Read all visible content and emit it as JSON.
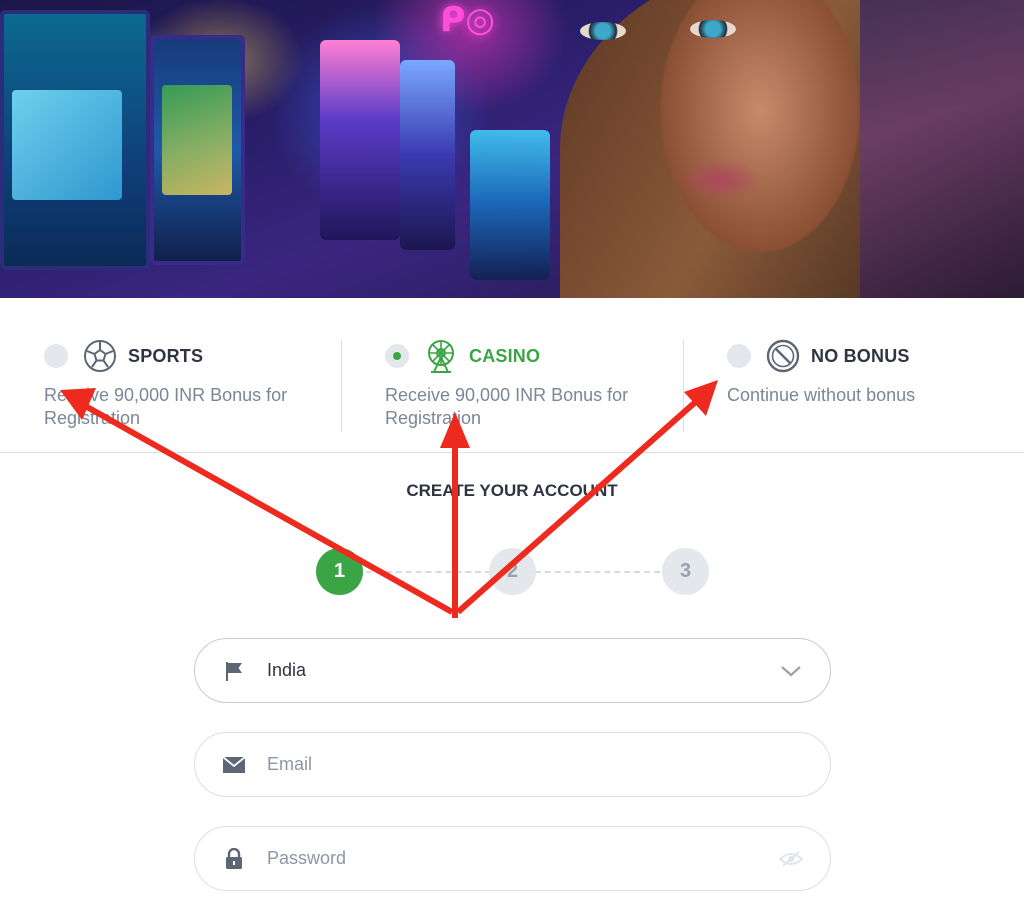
{
  "bonus_options": [
    {
      "icon": "soccer-ball-icon",
      "title": "SPORTS",
      "description": "Receive 90,000 INR Bonus for Registration",
      "selected": false
    },
    {
      "icon": "ferris-wheel-icon",
      "title": "CASINO",
      "description": "Receive 90,000 INR Bonus for Registration",
      "selected": true
    },
    {
      "icon": "prohibited-icon",
      "title": "NO BONUS",
      "description": "Continue without bonus",
      "selected": false
    }
  ],
  "form": {
    "title": "CREATE YOUR ACCOUNT",
    "steps": [
      "1",
      "2",
      "3"
    ],
    "active_step": 1,
    "country": {
      "icon": "flag-icon",
      "value": "India"
    },
    "email": {
      "icon": "envelope-icon",
      "placeholder": "Email"
    },
    "password": {
      "icon": "lock-icon",
      "placeholder": "Password"
    }
  },
  "colors": {
    "accent": "#3aa545",
    "text": "#2f3440",
    "muted": "#7b8698",
    "arrow": "#ee2a1f"
  }
}
